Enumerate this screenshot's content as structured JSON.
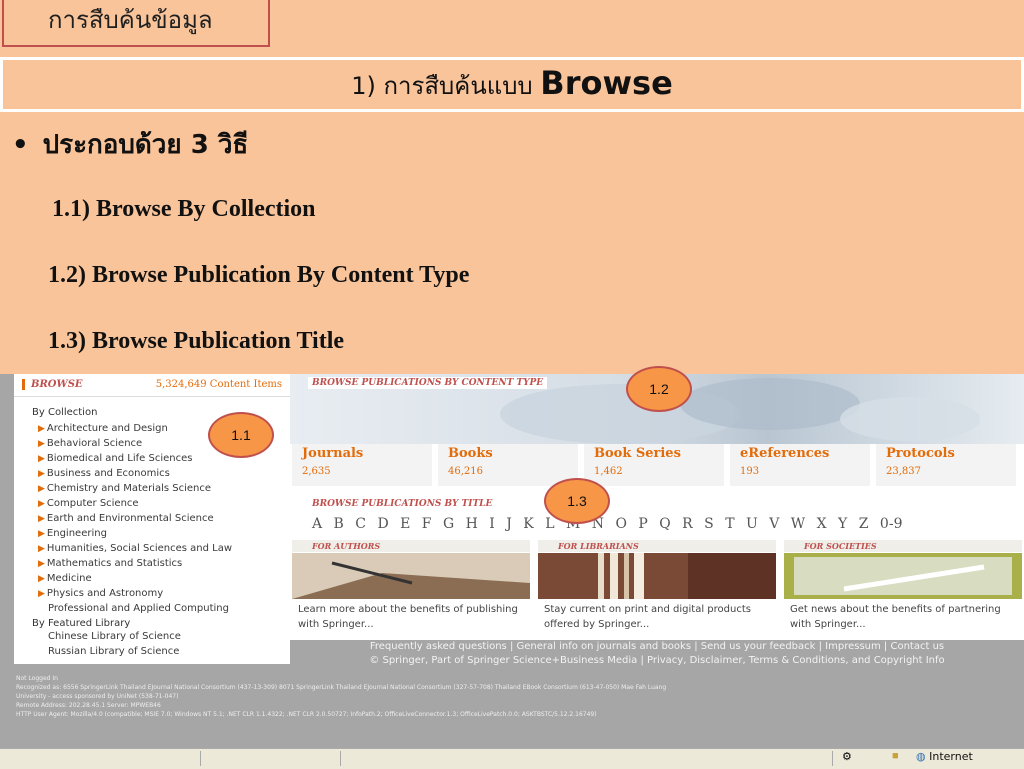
{
  "slide": {
    "title_tab": "การสืบค้นข้อมูล",
    "heading_prefix": "1) การสืบค้นแบบ ",
    "heading_bold": "Browse",
    "bullet": "ประกอบด้วย 3 วิธี",
    "items": [
      "1.1)  Browse By Collection",
      "1.2)  Browse Publication By Content Type",
      "1.3)  Browse Publication Title"
    ],
    "callouts": [
      "1.1",
      "1.2",
      "1.3"
    ],
    "colors": {
      "background": "#f9c49a",
      "callout_fill": "#f79646",
      "callout_border": "#c0504d",
      "accent": "#e36c0a"
    }
  },
  "springer": {
    "browse_label": "BROWSE",
    "content_items": "5,324,649 Content Items",
    "by_collection": "By Collection",
    "collections": [
      "Architecture and Design",
      "Behavioral Science",
      "Biomedical and Life Sciences",
      "Business and Economics",
      "Chemistry and Materials Science",
      "Computer Science",
      "Earth and Environmental Science",
      "Engineering",
      "Humanities, Social Sciences and Law",
      "Mathematics and Statistics",
      "Medicine",
      "Physics and Astronomy",
      "Professional and Applied Computing"
    ],
    "by_featured": "By Featured Library",
    "featured": [
      "Chinese Library of Science",
      "Russian Library of Science"
    ],
    "by_content_type_label": "BROWSE PUBLICATIONS BY CONTENT TYPE",
    "content_types": [
      {
        "name": "Journals",
        "count": "2,635"
      },
      {
        "name": "Books",
        "count": "46,216"
      },
      {
        "name": "Book Series",
        "count": "1,462"
      },
      {
        "name": "eReferences",
        "count": "193"
      },
      {
        "name": "Protocols",
        "count": "23,837"
      }
    ],
    "by_title_label": "BROWSE PUBLICATIONS BY TITLE",
    "letters": "A B C D E F G H I J K L M N O P Q R S T U V W X Y Z 0-9",
    "promos": [
      {
        "header": "FOR AUTHORS",
        "text": "Learn more about the benefits of publishing with Springer..."
      },
      {
        "header": "FOR LIBRARIANS",
        "text": "Stay current on print and digital products offered by Springer..."
      },
      {
        "header": "FOR SOCIETIES",
        "text": "Get news about the benefits of partnering with Springer..."
      }
    ],
    "footer_links": "Frequently asked questions | General info on journals and books | Send us your feedback | Impressum | Contact us",
    "footer_copyright": "© Springer, Part of Springer Science+Business Media | Privacy, Disclaimer, Terms & Conditions, and Copyright Info",
    "status_lines": [
      "Not Logged In",
      "Recognized as: 6556 SpringerLink Thailand EJournal National Consortium (437-13-309) 8071 SpringerLink Thailand EJournal National Consortium (327-57-708) Thailand EBook Consortium (613-47-050) Mae Fah Luang",
      "University - access sponsored by UniNet (538-71-047)",
      "Remote Address: 202.28.45.1   Server: MPWEB46",
      "HTTP User Agent: Mozilla/4.0 (compatible; MSIE 7.0; Windows NT 5.1; .NET CLR 1.1.4322; .NET CLR 2.0.50727; InfoPath.2; OfficeLiveConnector.1.3; OfficeLivePatch.0.0; ASKTBSTC/5.12.2.16749)"
    ],
    "statusbar_zone": "Internet"
  }
}
